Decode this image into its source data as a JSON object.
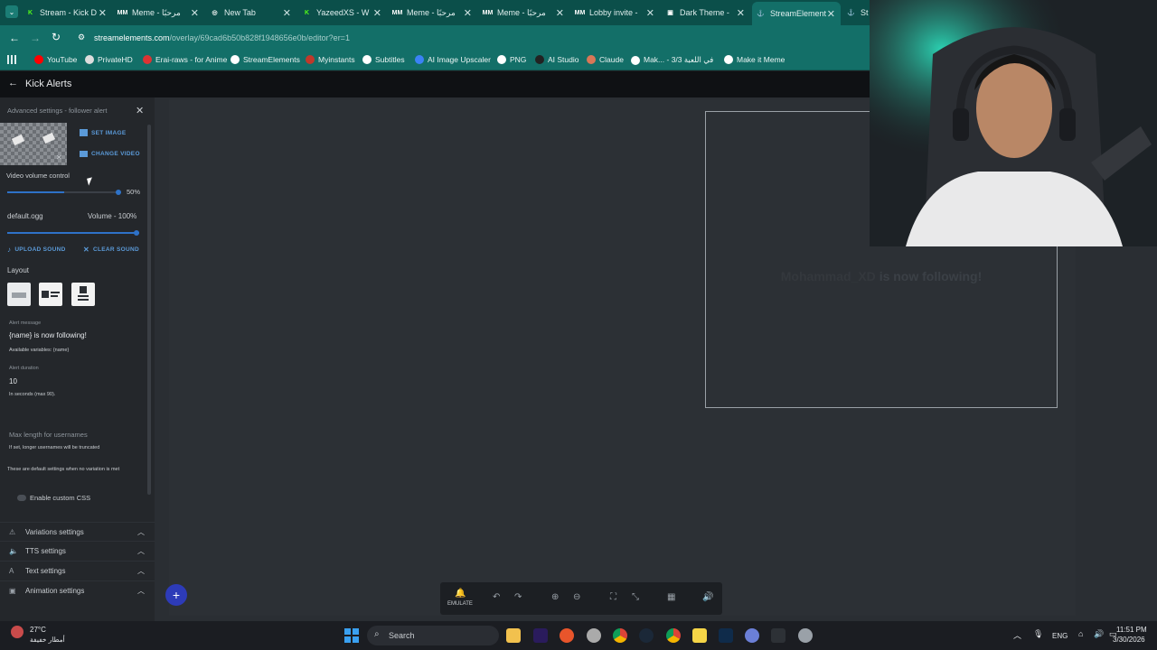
{
  "browser": {
    "tabs": [
      {
        "label": "Stream - Kick D",
        "fav": "K",
        "color": "#53fc18"
      },
      {
        "label": "Meme - مرحبًا",
        "fav": "MM",
        "color": "#ffffff"
      },
      {
        "label": "New Tab",
        "fav": "◎",
        "color": "#ffffff"
      },
      {
        "label": "YazeedXS - W",
        "fav": "K",
        "color": "#53fc18"
      },
      {
        "label": "Meme - مرحبًا",
        "fav": "MM",
        "color": "#ffffff"
      },
      {
        "label": "Meme - مرحبًا",
        "fav": "MM",
        "color": "#ffffff"
      },
      {
        "label": "Lobby invite - ",
        "fav": "MM",
        "color": "#ffffff"
      },
      {
        "label": "Dark Theme - ",
        "fav": "▣",
        "color": "#ffffff"
      },
      {
        "label": "StreamElement",
        "fav": "⚓",
        "color": "#ffffff"
      },
      {
        "label": "St",
        "fav": "⚓",
        "color": "#ffffff"
      }
    ],
    "url_host": "streamelements.com",
    "url_path": "/overlay/69cad6b50b828f1948656e0b/editor?er=1",
    "bookmarks": [
      {
        "label": "YouTube",
        "color": "#ff0000"
      },
      {
        "label": "PrivateHD",
        "color": "#dddddd"
      },
      {
        "label": "Erai-raws - for Anime",
        "color": "#d33"
      },
      {
        "label": "StreamElements",
        "color": "#ffffff"
      },
      {
        "label": "Myinstants",
        "color": "#c0392b"
      },
      {
        "label": "Subtitles",
        "color": "#ffffff"
      },
      {
        "label": "AI Image Upscaler",
        "color": "#3b82f6"
      },
      {
        "label": "PNG",
        "color": "#ffffff"
      },
      {
        "label": "AI Studio",
        "color": "#222222"
      },
      {
        "label": "Claude",
        "color": "#d97757"
      },
      {
        "label": "Mak... - 3/3 في اللعبة",
        "color": "#ffffff"
      },
      {
        "label": "Make it Meme",
        "color": "#ffffff"
      }
    ]
  },
  "app": {
    "title": "Kick Alerts"
  },
  "sidebar": {
    "header": "Advanced settings - follower alert",
    "set_image": "SET IMAGE",
    "change_video": "CHANGE VIDEO",
    "video_volume_label": "Video volume control",
    "video_volume_value": "50%",
    "video_volume": 0.5,
    "sound_file": "default.ogg",
    "sound_volume_label": "Volume - 100%",
    "sound_volume": 1.0,
    "upload_sound": "UPLOAD SOUND",
    "clear_sound": "CLEAR SOUND",
    "layout_label": "Layout",
    "alert_message_label": "Alert message",
    "alert_message_value": "{name} is now following!",
    "available_vars": "Available variables: {name}",
    "alert_duration_label": "Alert duration",
    "alert_duration_value": "10",
    "alert_duration_help": "In seconds (max 90).",
    "max_length_label": "Max length for usernames",
    "max_length_help": "If set, longer usernames will be truncated",
    "default_settings_note": "These are default settings when no variation is met",
    "custom_css_label": "Enable custom CSS",
    "sections": [
      "Variations settings",
      "TTS settings",
      "Text settings",
      "Animation settings"
    ]
  },
  "preview": {
    "username": "Mohammad_XD",
    "message_tail": "is now following!"
  },
  "toolbar": {
    "emulate": "EMULATE"
  },
  "taskbar": {
    "temperature": "27°C",
    "weather": "أمطار خفيفة",
    "search": "Search",
    "lang": "ENG",
    "time": "11:51 PM",
    "date": "3/30/2026"
  }
}
